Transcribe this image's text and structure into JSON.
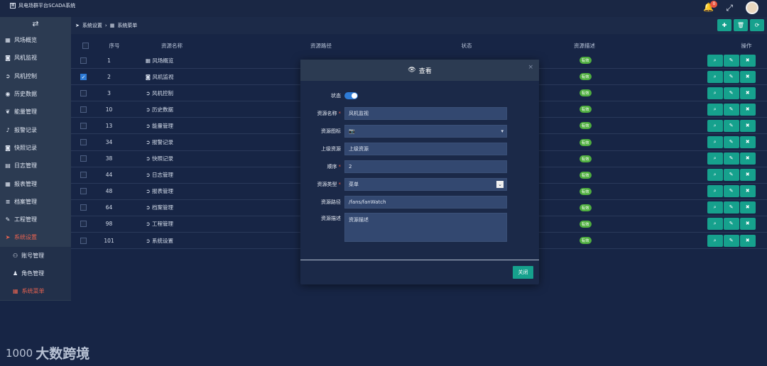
{
  "header": {
    "title": "风电场群平台SCADA系统",
    "notification_count": "0"
  },
  "sidebar": {
    "toggle_icon": "swap-icon",
    "items": [
      {
        "label": "风场概览",
        "icon": "grid-icon"
      },
      {
        "label": "风机监视",
        "icon": "camera-icon"
      },
      {
        "label": "风机控制",
        "icon": "circle-arrow-icon"
      },
      {
        "label": "历史数据",
        "icon": "database-icon"
      },
      {
        "label": "能量管理",
        "icon": "leaf-icon"
      },
      {
        "label": "报警记录",
        "icon": "bell-icon"
      },
      {
        "label": "快照记录",
        "icon": "camera-icon"
      },
      {
        "label": "日志管理",
        "icon": "book-icon"
      },
      {
        "label": "报表管理",
        "icon": "table-icon"
      },
      {
        "label": "档案管理",
        "icon": "list-icon"
      },
      {
        "label": "工程管理",
        "icon": "wrench-icon"
      },
      {
        "label": "系统设置",
        "icon": "send-icon",
        "active": true
      }
    ],
    "subitems": [
      {
        "label": "账号管理",
        "icon": "users-icon"
      },
      {
        "label": "角色管理",
        "icon": "user-icon"
      },
      {
        "label": "系统菜单",
        "icon": "table-icon",
        "active": true
      }
    ]
  },
  "breadcrumb": {
    "parent": "系统设置",
    "current": "系统菜单"
  },
  "table": {
    "headers": {
      "no": "序号",
      "name": "资源名称",
      "path": "资源路径",
      "state": "状态",
      "desc": "资源描述",
      "ops": "操作"
    },
    "rows": [
      {
        "no": "1",
        "name": "风场概览",
        "state": "有效",
        "checked": false
      },
      {
        "no": "2",
        "name": "风机监视",
        "state": "有效",
        "checked": true
      },
      {
        "no": "3",
        "name": "风机控制",
        "state": "有效",
        "checked": false
      },
      {
        "no": "10",
        "name": "历史数据",
        "state": "有效",
        "checked": false
      },
      {
        "no": "13",
        "name": "能量管理",
        "state": "有效",
        "checked": false
      },
      {
        "no": "34",
        "name": "报警记录",
        "state": "有效",
        "checked": false
      },
      {
        "no": "38",
        "name": "快照记录",
        "state": "有效",
        "checked": false
      },
      {
        "no": "44",
        "name": "日志管理",
        "state": "有效",
        "checked": false
      },
      {
        "no": "48",
        "name": "报表管理",
        "state": "有效",
        "checked": false
      },
      {
        "no": "64",
        "name": "档案管理",
        "state": "有效",
        "checked": false
      },
      {
        "no": "98",
        "name": "工程管理",
        "state": "有效",
        "checked": false
      },
      {
        "no": "101",
        "name": "系统设置",
        "state": "有效",
        "checked": false
      }
    ]
  },
  "modal": {
    "title": "查看",
    "close_symbol": "×",
    "labels": {
      "state": "状态",
      "name": "资源名称",
      "icon": "资源图标",
      "parent": "上级资源",
      "order": "顺序",
      "type": "资源类型",
      "path": "资源路径",
      "desc": "资源描述"
    },
    "values": {
      "state_on": true,
      "name": "风机监视",
      "icon": "camera-icon",
      "parent_placeholder": "上级资源",
      "order": "2",
      "type": "菜单",
      "path": "/fans/fanWatch",
      "desc_placeholder": "资源描述"
    },
    "close_button": "关闭"
  },
  "watermark": {
    "text": "大数跨境",
    "logo": "1000"
  },
  "colors": {
    "accent": "#16a18d",
    "active": "#ea6350",
    "valid": "#4fae3f"
  }
}
